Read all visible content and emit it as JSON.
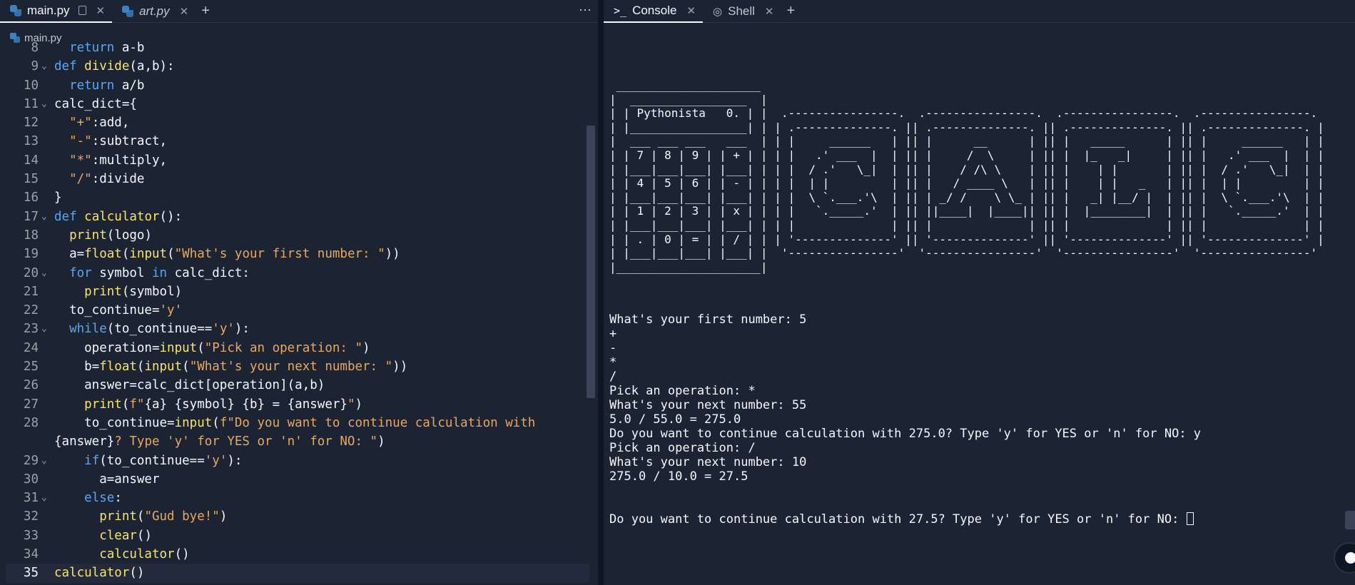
{
  "editor": {
    "tabs": [
      {
        "label": "main.py"
      },
      {
        "label": "art.py"
      }
    ],
    "add_tab": "+",
    "more": "⋯",
    "breadcrumb": "main.py"
  },
  "code_lines": [
    {
      "n": "8",
      "html": "  <span class=\"kw\">return</span> a-b",
      "fold": false
    },
    {
      "n": "9",
      "html": "<span class=\"kw\">def</span> <span class=\"fn\">divide</span>(a,b):",
      "fold": true
    },
    {
      "n": "10",
      "html": "  <span class=\"kw\">return</span> a/b",
      "fold": false
    },
    {
      "n": "11",
      "html": "calc_dict={",
      "fold": true
    },
    {
      "n": "12",
      "html": "  <span class=\"str\">\"+\"</span>:add,",
      "fold": false
    },
    {
      "n": "13",
      "html": "  <span class=\"str\">\"-\"</span>:subtract,",
      "fold": false
    },
    {
      "n": "14",
      "html": "  <span class=\"str\">\"*\"</span>:multiply,",
      "fold": false
    },
    {
      "n": "15",
      "html": "  <span class=\"str\">\"/\"</span>:divide",
      "fold": false
    },
    {
      "n": "16",
      "html": "}",
      "fold": false
    },
    {
      "n": "17",
      "html": "<span class=\"kw\">def</span> <span class=\"fn\">calculator</span>():",
      "fold": true
    },
    {
      "n": "18",
      "html": "  <span class=\"fn\">print</span>(logo)",
      "fold": false
    },
    {
      "n": "19",
      "html": "  a=<span class=\"fn\">float</span>(<span class=\"fn\">input</span>(<span class=\"str\">\"What's your first number: \"</span>))",
      "fold": false
    },
    {
      "n": "20",
      "html": "  <span class=\"kw\">for</span> symbol <span class=\"kw\">in</span> calc_dict:",
      "fold": true
    },
    {
      "n": "21",
      "html": "    <span class=\"fn\">print</span>(symbol)",
      "fold": false
    },
    {
      "n": "22",
      "html": "  to_continue=<span class=\"str\">'y'</span>",
      "fold": false
    },
    {
      "n": "23",
      "html": "  <span class=\"kw\">while</span>(to_continue==<span class=\"str\">'y'</span>):",
      "fold": true
    },
    {
      "n": "24",
      "html": "    operation=<span class=\"fn\">input</span>(<span class=\"str\">\"Pick an operation: \"</span>)",
      "fold": false
    },
    {
      "n": "25",
      "html": "    b=<span class=\"fn\">float</span>(<span class=\"fn\">input</span>(<span class=\"str\">\"What's your next number: \"</span>))",
      "fold": false
    },
    {
      "n": "26",
      "html": "    answer=calc_dict[operation](a,b)",
      "fold": false
    },
    {
      "n": "27",
      "html": "    <span class=\"fn\">print</span>(<span class=\"str\">f\"</span>{a} {symbol} {b} = {answer}<span class=\"str\">\"</span>)",
      "fold": false
    },
    {
      "n": "28",
      "html": "    to_continue=<span class=\"fn\">input</span>(<span class=\"str\">f\"Do you want to continue calculation with </span>\n{answer}<span class=\"str\">? Type 'y' for YES or 'n' for NO: \"</span>)",
      "fold": false,
      "wrap": true
    },
    {
      "n": "29",
      "html": "    <span class=\"kw\">if</span>(to_continue==<span class=\"str\">'y'</span>):",
      "fold": true
    },
    {
      "n": "30",
      "html": "      a=answer",
      "fold": false
    },
    {
      "n": "31",
      "html": "    <span class=\"kw\">else</span>:",
      "fold": true
    },
    {
      "n": "32",
      "html": "      <span class=\"fn\">print</span>(<span class=\"str\">\"Gud bye!\"</span>)",
      "fold": false
    },
    {
      "n": "33",
      "html": "      <span class=\"fn\">clear</span>()",
      "fold": false
    },
    {
      "n": "34",
      "html": "      <span class=\"fn\">calculator</span>()",
      "fold": false
    },
    {
      "n": "35",
      "html": "<span class=\"fn\">calculator</span>()",
      "fold": false,
      "current": true
    }
  ],
  "console": {
    "tabs": [
      {
        "label": "Console"
      },
      {
        "label": "Shell"
      }
    ],
    "add_tab": "+",
    "ascii_logo": " _____________________\n|  _________________  |\n| | Pythonista   0. | |  .----------------.  .----------------.  .----------------.  .----------------.\n| |_________________| | | .--------------. || .--------------. || .--------------. || .--------------. |\n|  ___ ___ ___   ___  | | |     ______   | || |      __      | || |   _____      | || |     ______   | |\n| | 7 | 8 | 9 | | + | | | |   .' ___  |  | || |     /  \\     | || |  |_   _|     | || |   .' ___  |  | |\n| |___|___|___| |___| | | |  / .'   \\_|  | || |    / /\\ \\    | || |    | |       | || |  / .'   \\_|  | |\n| | 4 | 5 | 6 | | - | | | |  | |         | || |   / ____ \\   | || |    | |   _   | || |  | |         | |\n| |___|___|___| |___| | | |  \\ `.___.'\\  | || | _/ /    \\ \\_ | || |   _| |__/ |  | || |  \\ `.___.'\\  | |\n| | 1 | 2 | 3 | | x | | | |   `._____.'  | || ||____|  |____|| || |  |________|  | || |   `._____.'  | |\n| |___|___|___| |___| | | |              | || |              | || |              | || |              | |\n| | . | 0 | = | | / | | | '--------------' || '--------------' || '--------------' || '--------------' |\n| |___|___|___| |___| |  '----------------'  '----------------'  '----------------'  '----------------'\n|_____________________|",
    "output_lines": [
      "What's your first number: 5",
      "+",
      "-",
      "*",
      "/",
      "Pick an operation: *",
      "What's your next number: 55",
      "5.0 / 55.0 = 275.0",
      "Do you want to continue calculation with 275.0? Type 'y' for YES or 'n' for NO: y",
      "Pick an operation: /",
      "What's your next number: 10",
      "275.0 / 10.0 = 27.5"
    ],
    "last_line": "Do you want to continue calculation with 27.5? Type 'y' for YES or 'n' for NO: "
  }
}
